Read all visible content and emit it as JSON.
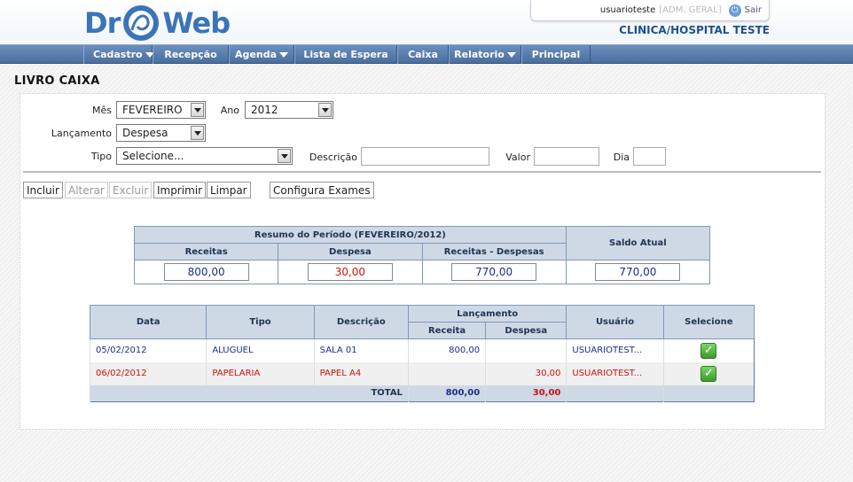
{
  "app": {
    "logo_left": "Dr",
    "logo_right": "Web",
    "user": "usuarioteste",
    "role": "[ADM. GERAL]",
    "logout": "Sair",
    "clinic": "CLINICA/HOSPITAL TESTE"
  },
  "menu": [
    {
      "label": "Cadastro",
      "dropdown": true
    },
    {
      "label": "Recepção",
      "dropdown": false
    },
    {
      "label": "Agenda",
      "dropdown": true
    },
    {
      "label": "Lista de Espera",
      "dropdown": false
    },
    {
      "label": "Caixa",
      "dropdown": false
    },
    {
      "label": "Relatorio",
      "dropdown": true
    },
    {
      "label": "Principal",
      "dropdown": false
    }
  ],
  "page_title": "LIVRO CAIXA",
  "form": {
    "mes_label": "Mês",
    "mes_value": "FEVEREIRO",
    "ano_label": "Ano",
    "ano_value": "2012",
    "lancamento_label": "Lançamento",
    "lancamento_value": "Despesa",
    "tipo_label": "Tipo",
    "tipo_value": "Selecione...",
    "descricao_label": "Descrição",
    "descricao_value": "",
    "valor_label": "Valor",
    "valor_value": "",
    "dia_label": "Dia",
    "dia_value": ""
  },
  "buttons": {
    "incluir": "Incluir",
    "alterar": "Alterar",
    "excluir": "Excluir",
    "imprimir": "Imprimir",
    "limpar": "Limpar",
    "configura": "Configura Exames"
  },
  "summary": {
    "header": "Resumo do Período (FEVEREIRO/2012)",
    "saldo_header": "Saldo Atual",
    "receitas_label": "Receitas",
    "despesas_label": "Despesa",
    "diff_label": "Receitas - Despesas",
    "receitas": "800,00",
    "despesas": "30,00",
    "diff": "770,00",
    "saldo": "770,00"
  },
  "grid": {
    "headers": {
      "data": "Data",
      "tipo": "Tipo",
      "descricao": "Descrição",
      "lancamento": "Lançamento",
      "receita": "Receita",
      "despesa": "Despesa",
      "usuario": "Usuário",
      "selecione": "Selecione"
    },
    "rows": [
      {
        "data": "05/02/2012",
        "tipo": "ALUGUEL",
        "descricao": "SALA 01",
        "receita": "800,00",
        "despesa": "",
        "usuario": "USUARIOTEST..."
      },
      {
        "data": "06/02/2012",
        "tipo": "PAPELARIA",
        "descricao": "PAPEL A4",
        "receita": "",
        "despesa": "30,00",
        "usuario": "USUARIOTEST..."
      }
    ],
    "total": {
      "label": "TOTAL",
      "receita": "800,00",
      "despesa": "30,00"
    }
  },
  "colors": {
    "receita": "#1a2f8a",
    "despesa": "#cc1111",
    "accent": "#4a6f9f"
  }
}
